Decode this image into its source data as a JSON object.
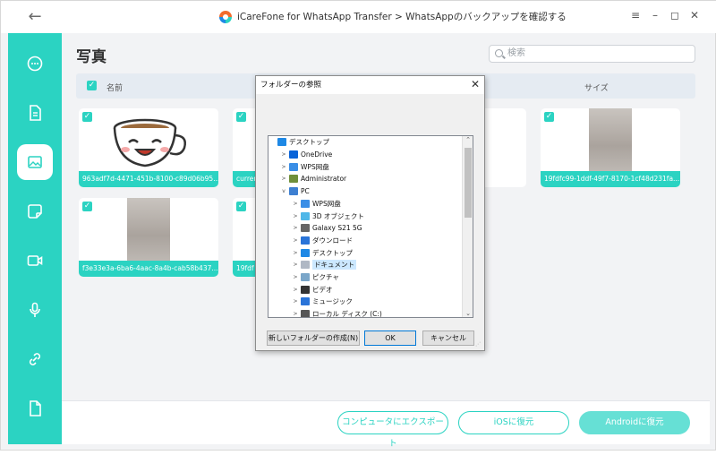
{
  "app": {
    "title": "iCareFone for WhatsApp Transfer > WhatsAppのバックアップを確認する",
    "colors": {
      "accent": "#2bd3c2",
      "accent_light": "#66e0d5",
      "header_bg": "#e5ebf2"
    }
  },
  "titlebar": {
    "back_icon": "←",
    "menu_icon": "≡",
    "minimize_icon": "–",
    "maximize_icon": "◻",
    "close_icon": "✕"
  },
  "sidebar": {
    "items": [
      {
        "icon": "chat-bubble-icon",
        "active": false
      },
      {
        "icon": "document-icon",
        "active": false
      },
      {
        "icon": "photo-icon",
        "active": true
      },
      {
        "icon": "sticker-icon",
        "active": false
      },
      {
        "icon": "video-icon",
        "active": false
      },
      {
        "icon": "microphone-icon",
        "active": false
      },
      {
        "icon": "link-icon",
        "active": false
      },
      {
        "icon": "file-icon",
        "active": false
      }
    ]
  },
  "main": {
    "title": "写真",
    "search_placeholder": "検索",
    "columns": {
      "name": "名前",
      "size": "サイズ"
    },
    "check_glyph": "✓",
    "thumbnails": [
      {
        "caption": "963adf7d-4471-451b-8100-c89d06b95..."
      },
      {
        "caption": "curren"
      },
      {
        "caption": "19fdfc99-1ddf-49f7-8170-1cf48d231fa..."
      },
      {
        "caption": "f3e33e3a-6ba6-4aac-8a4b-cab58b437..."
      },
      {
        "caption": "19fdf"
      }
    ]
  },
  "footer": {
    "export_label": "コンピュータにエクスポート",
    "ios_label": "iOSに復元",
    "android_label": "Androidに復元"
  },
  "dialog": {
    "title": "フォルダーの参照",
    "close_glyph": "✕",
    "tree": [
      {
        "label": "デスクトップ",
        "level": 0,
        "expander": "",
        "icon_color": "#1e88e5"
      },
      {
        "label": "OneDrive",
        "level": 1,
        "expander": ">",
        "icon_color": "#0a64d8"
      },
      {
        "label": "WPS网盘",
        "level": 1,
        "expander": ">",
        "icon_color": "#3a8ee6"
      },
      {
        "label": "Administrator",
        "level": 1,
        "expander": ">",
        "icon_color": "#6f8f3a"
      },
      {
        "label": "PC",
        "level": 1,
        "expander": "v",
        "icon_color": "#3d7fd1"
      },
      {
        "label": "WPS网盘",
        "level": 2,
        "expander": ">",
        "icon_color": "#3a8ee6"
      },
      {
        "label": "3D オブジェクト",
        "level": 2,
        "expander": ">",
        "icon_color": "#4fb7e8"
      },
      {
        "label": "Galaxy S21 5G",
        "level": 2,
        "expander": ">",
        "icon_color": "#666666"
      },
      {
        "label": "ダウンロード",
        "level": 2,
        "expander": ">",
        "icon_color": "#2a74d8"
      },
      {
        "label": "デスクトップ",
        "level": 2,
        "expander": ">",
        "icon_color": "#1e88e5"
      },
      {
        "label": "ドキュメント",
        "level": 2,
        "expander": ">",
        "icon_color": "#b0b8c4",
        "selected": true
      },
      {
        "label": "ピクチャ",
        "level": 2,
        "expander": ">",
        "icon_color": "#7aa6c9"
      },
      {
        "label": "ビデオ",
        "level": 2,
        "expander": ">",
        "icon_color": "#333333"
      },
      {
        "label": "ミュージック",
        "level": 2,
        "expander": ">",
        "icon_color": "#2a74d8"
      },
      {
        "label": "ローカル ディスク (C:)",
        "level": 2,
        "expander": ">",
        "icon_color": "#555555"
      }
    ],
    "scroll_up": "⌃",
    "scroll_down": "⌄",
    "new_folder_label": "新しいフォルダーの作成(N)",
    "ok_label": "OK",
    "cancel_label": "キャンセル"
  }
}
